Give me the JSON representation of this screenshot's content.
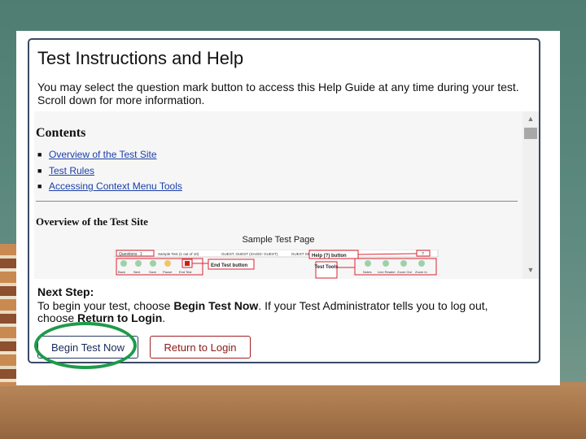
{
  "page": {
    "title": "Test Instructions and Help",
    "intro": "You may select the question mark button to access this Help Guide at any time during your test. Scroll down for more information."
  },
  "help_content": {
    "contents_heading": "Contents",
    "toc": [
      {
        "label": "Overview of the Test Site"
      },
      {
        "label": "Test Rules"
      },
      {
        "label": "Accessing Context Menu Tools"
      }
    ],
    "overview_heading": "Overview of the Test Site",
    "sample_caption": "Sample Test Page",
    "sample_labels": {
      "questions": "Questions",
      "question_num": "1",
      "test_info": "Sample Test (1 out of 10)",
      "guest": "GUEST, GUEST (SAGID: GUEST)",
      "session": "GUEST SESSION",
      "help_button": "Help (?) button",
      "end_test_button": "End Test button",
      "test_tools": "Test Tools",
      "back": "Back",
      "next": "Next",
      "save": "Save",
      "pause": "Pause",
      "end_test": "End Test",
      "notes": "Notes",
      "line_reader": "Line Reader",
      "zoom_out": "Zoom Out",
      "zoom_in": "Zoom In"
    }
  },
  "next_step": {
    "heading": "Next Step:",
    "text_1": "To begin your test, choose ",
    "begin_ref": "Begin Test Now",
    "text_2": ". If your Test Administrator tells you to log out, choose ",
    "return_ref": "Return to Login",
    "text_3": "."
  },
  "buttons": {
    "begin": "Begin Test Now",
    "return": "Return to Login"
  },
  "colors": {
    "link": "#1a3fa8",
    "button_border": "#a02020",
    "highlight_ring": "#1f9a4a",
    "panel_border": "#3a4a66"
  }
}
